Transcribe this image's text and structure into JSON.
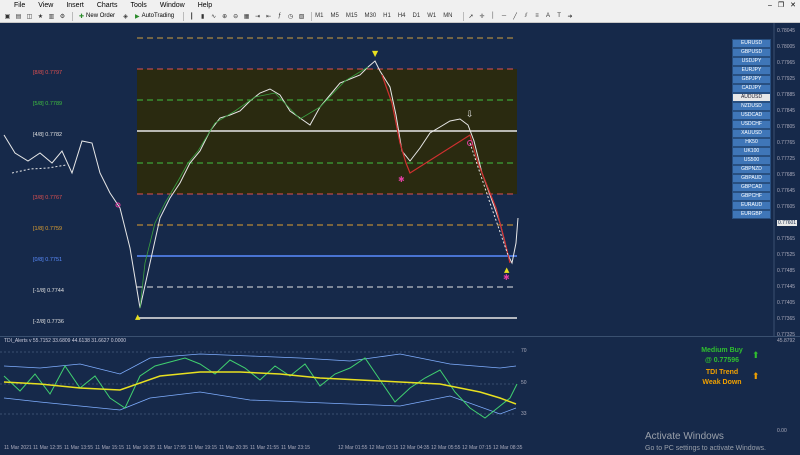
{
  "menu": [
    "File",
    "View",
    "Insert",
    "Charts",
    "Tools",
    "Window",
    "Help"
  ],
  "toolbar": {
    "new_order": "New Order",
    "autotrading": "AutoTrading",
    "timeframes": [
      "M1",
      "M5",
      "M15",
      "M30",
      "H1",
      "H4",
      "D1",
      "W1",
      "MN"
    ]
  },
  "chart": {
    "levels": [
      {
        "label": "[8/8]",
        "value": "0.7797",
        "color": "#e05050"
      },
      {
        "label": "[5/8]",
        "value": "0.7789",
        "color": "#40c040"
      },
      {
        "label": "[4/8]",
        "value": "0.7782",
        "color": "#e0e0e0"
      },
      {
        "label": "[3/8]",
        "value": "0.7767",
        "color": "#e05050"
      },
      {
        "label": "[1/8]",
        "value": "0.7759",
        "color": "#e0a030"
      },
      {
        "label": "[0/8]",
        "value": "0.7751",
        "color": "#5a8cff"
      },
      {
        "label": "[-1/8]",
        "value": "0.7744",
        "color": "#e0e0e0"
      },
      {
        "label": "[-2/8]",
        "value": "0.7736",
        "color": "#e0e0e0"
      }
    ],
    "current_price": "0.77601",
    "price_axis": [
      "0.78045",
      "0.78005",
      "0.77965",
      "0.77925",
      "0.77885",
      "0.77845",
      "0.77805",
      "0.77765",
      "0.77725",
      "0.77685",
      "0.77645",
      "0.77605",
      "0.77565",
      "0.77525",
      "0.77485",
      "0.77445",
      "0.77405",
      "0.77365",
      "0.77325"
    ]
  },
  "pairs": [
    "EURUSD",
    "GBPUSD",
    "USDJPY",
    "EURJPY",
    "GBPJPY",
    "CADJPY",
    "AUDUSD",
    "NZDUSD",
    "USDCAD",
    "USDCHF",
    "XAUUSD",
    "HK50",
    "UK100",
    "US500",
    "GBPNZD",
    "GBPAUD",
    "GBPCAD",
    "GBPCHF",
    "EURAUD",
    "EURGBP"
  ],
  "selected_pair": "AUDUSD",
  "indicator": {
    "title": "TDI_Alerts v 55.7152 33.6809 44.6138 31.6627 0.0000",
    "levels": [
      "70",
      "50",
      "33"
    ],
    "axis": [
      "45.8792",
      "0.00"
    ],
    "signal1": "Medium Buy",
    "signal2": "@ 0.77596",
    "trend1": "TDI Trend",
    "trend2": "Weak Down",
    "signal_color": "#2fbf2f",
    "trend_color": "#f0a000"
  },
  "time_ticks": [
    "11 Mar 2021",
    "11 Mar 12:35",
    "11 Mar 13:55",
    "11 Mar 15:15",
    "11 Mar 16:35",
    "11 Mar 17:55",
    "11 Mar 19:15",
    "11 Mar 20:35",
    "11 Mar 21:55",
    "11 Mar 23:15",
    "12 Mar 01:55",
    "12 Mar 03:15",
    "12 Mar 04:35",
    "12 Mar 05:55",
    "12 Mar 07:15",
    "12 Mar 08:35"
  ],
  "watermark": {
    "line1": "Activate Windows",
    "line2": "Go to PC settings to activate Windows."
  }
}
